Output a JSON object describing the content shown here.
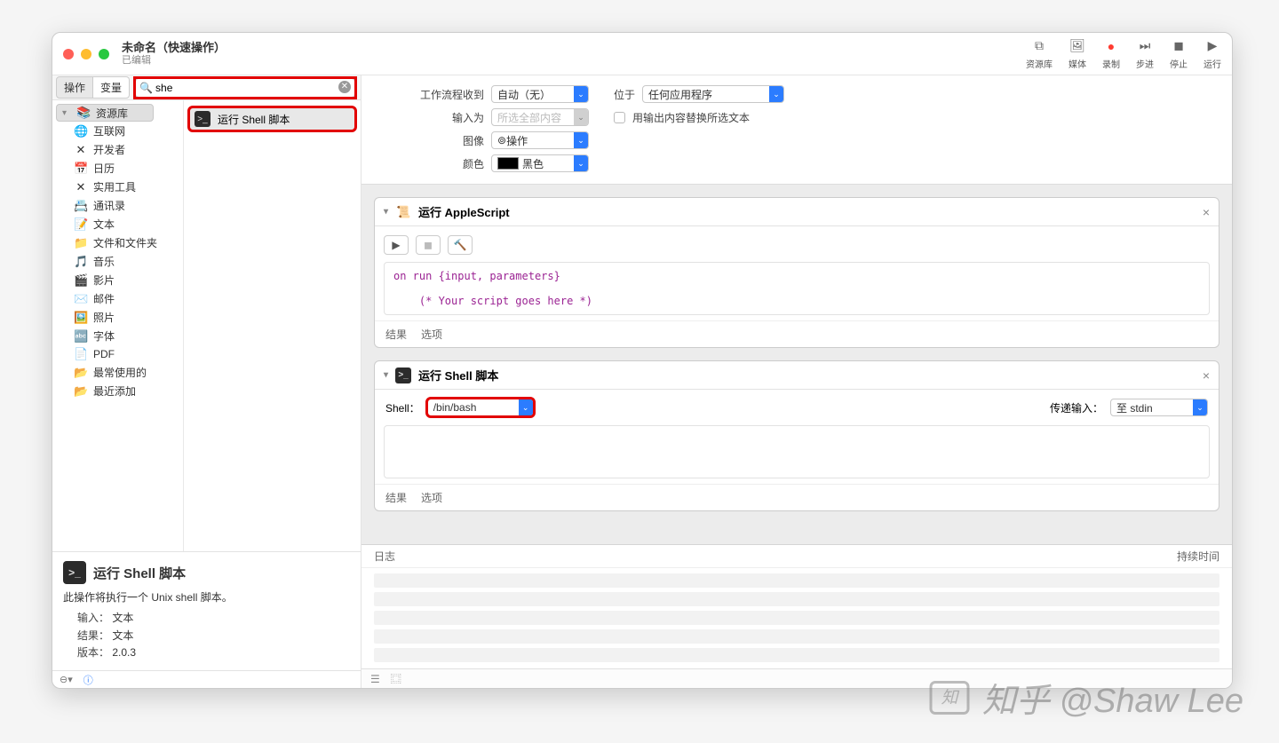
{
  "window": {
    "title": "未命名（快速操作）",
    "subtitle": "已编辑"
  },
  "toolbar": [
    {
      "label": "资源库",
      "color": ""
    },
    {
      "label": "媒体",
      "color": ""
    },
    {
      "label": "录制",
      "color": "red"
    },
    {
      "label": "步进",
      "color": ""
    },
    {
      "label": "停止",
      "color": ""
    },
    {
      "label": "运行",
      "color": ""
    }
  ],
  "tabs": {
    "actions": "操作",
    "vars": "变量"
  },
  "search": {
    "value": "she"
  },
  "library": {
    "root": "资源库",
    "items": [
      {
        "icon": "🌐",
        "label": "互联网"
      },
      {
        "icon": "✕",
        "label": "开发者"
      },
      {
        "icon": "📅",
        "label": "日历"
      },
      {
        "icon": "✕",
        "label": "实用工具"
      },
      {
        "icon": "📇",
        "label": "通讯录"
      },
      {
        "icon": "📝",
        "label": "文本"
      },
      {
        "icon": "📁",
        "label": "文件和文件夹"
      },
      {
        "icon": "🎵",
        "label": "音乐"
      },
      {
        "icon": "🎬",
        "label": "影片"
      },
      {
        "icon": "✉️",
        "label": "邮件"
      },
      {
        "icon": "🖼️",
        "label": "照片"
      },
      {
        "icon": "🔤",
        "label": "字体"
      },
      {
        "icon": "📄",
        "label": "PDF"
      },
      {
        "icon": "📂",
        "label": "最常使用的"
      },
      {
        "icon": "📂",
        "label": "最近添加"
      }
    ]
  },
  "results": [
    {
      "label": "运行 Shell 脚本"
    }
  ],
  "desc": {
    "title": "运行 Shell 脚本",
    "text": "此操作将执行一个 Unix shell 脚本。",
    "input_label": "输入：",
    "input_value": "文本",
    "result_label": "结果：",
    "result_value": "文本",
    "version_label": "版本：",
    "version_value": "2.0.3"
  },
  "params": {
    "receives_label": "工作流程收到",
    "receives_value": "自动（无）",
    "at_label": "位于",
    "at_value": "任何应用程序",
    "input_as_label": "输入为",
    "input_as_value": "所选全部内容",
    "replace_label": "用输出内容替换所选文本",
    "image_label": "图像",
    "image_value": "操作",
    "color_label": "颜色",
    "color_value": "黑色"
  },
  "applescript": {
    "title": "运行 AppleScript",
    "code": "on run {input, parameters}\n\n    (* Your script goes here *)",
    "footer": {
      "results": "结果",
      "options": "选项"
    }
  },
  "shell": {
    "title": "运行 Shell 脚本",
    "shell_label": "Shell：",
    "shell_value": "/bin/bash",
    "pass_label": "传递输入：",
    "pass_value": "至 stdin",
    "footer": {
      "results": "结果",
      "options": "选项"
    }
  },
  "logs": {
    "col_log": "日志",
    "col_duration": "持续时间"
  },
  "watermark": "知乎 @Shaw Lee"
}
